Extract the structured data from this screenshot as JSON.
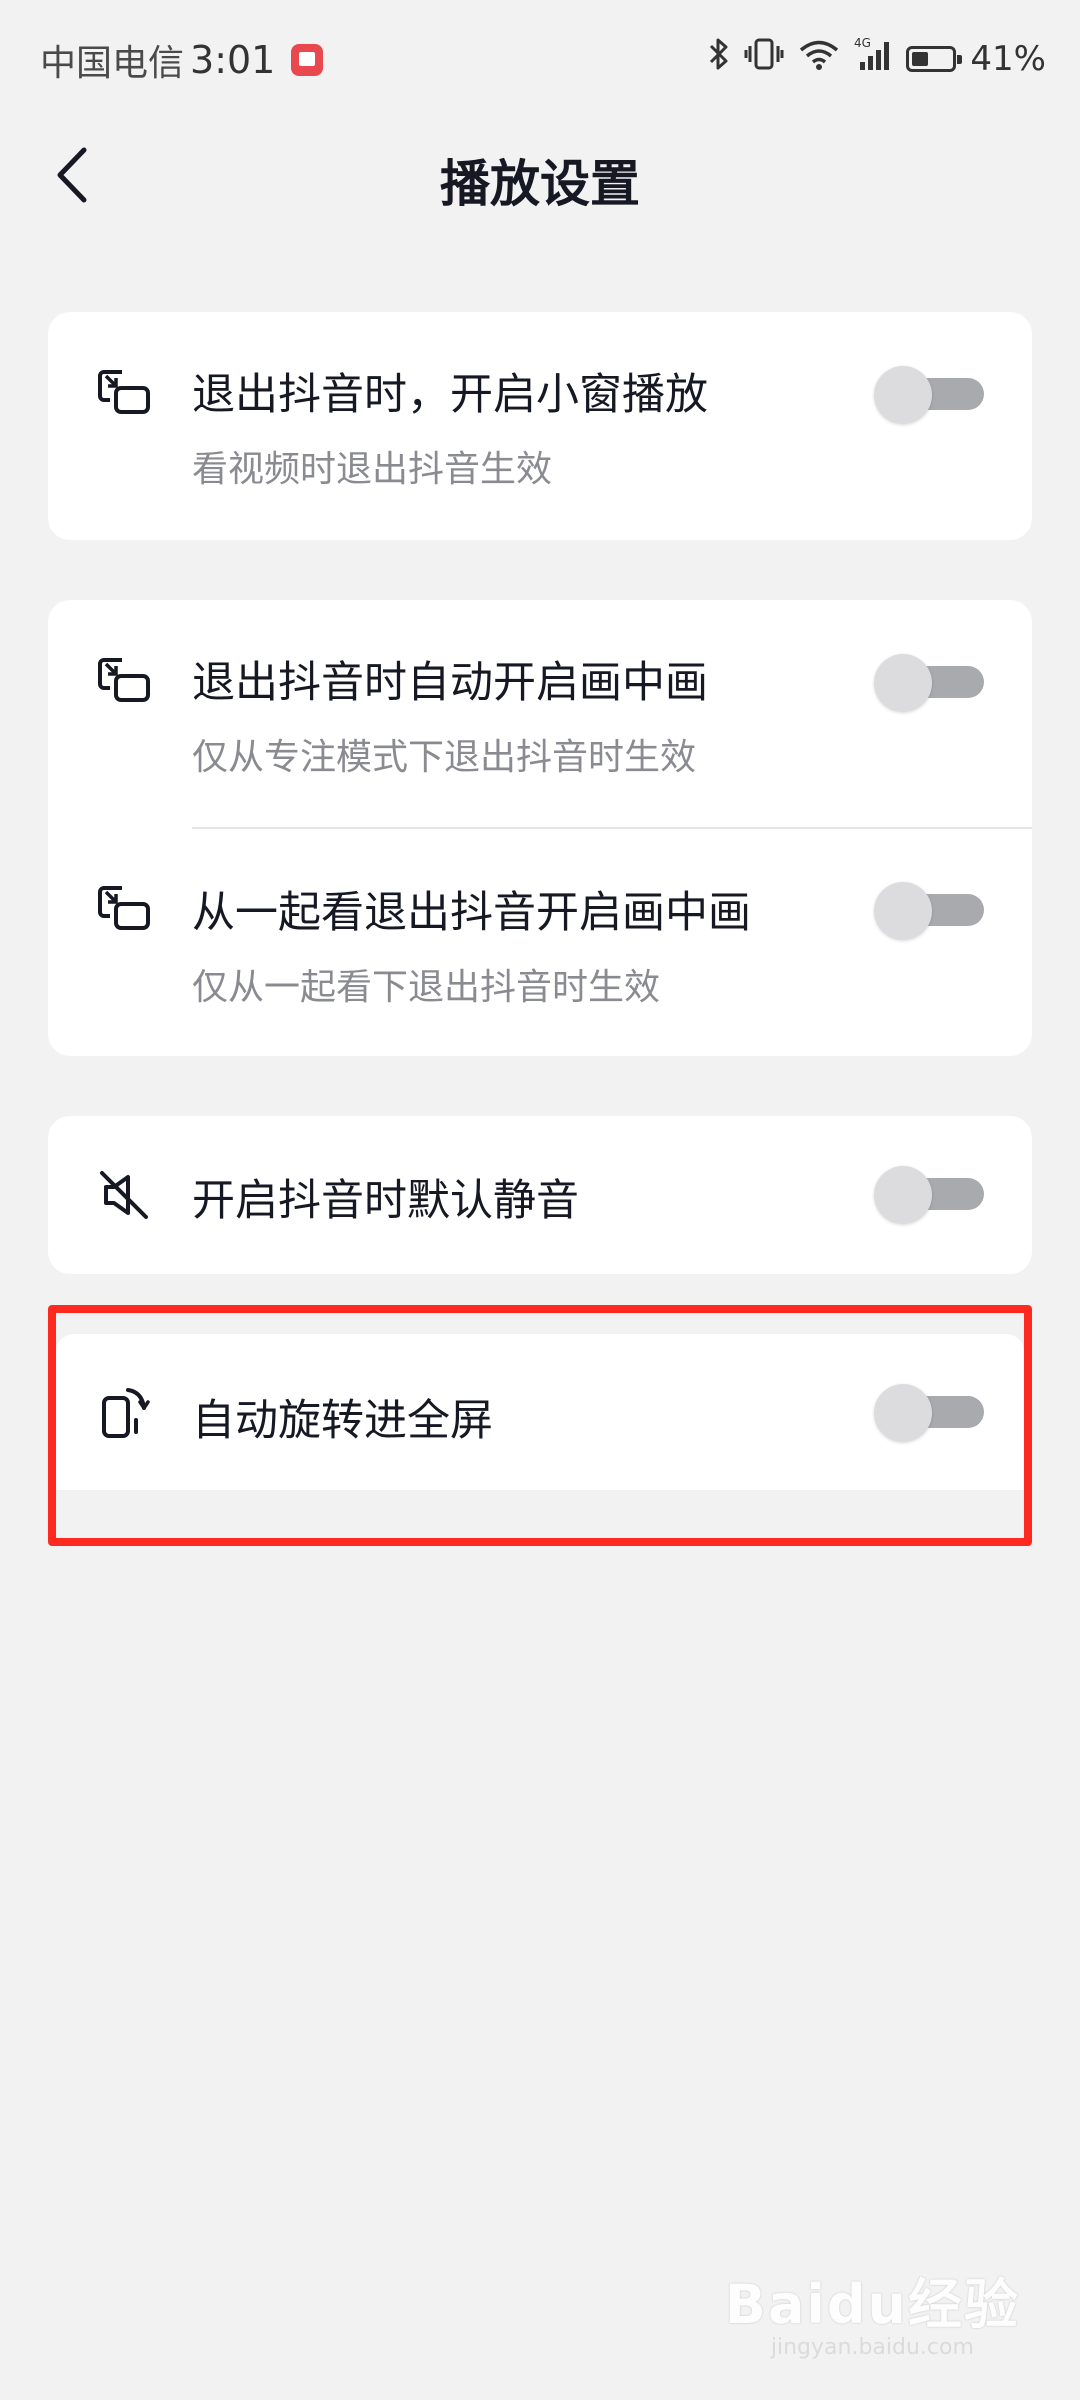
{
  "status_bar": {
    "carrier": "中国电信",
    "time": "3:01",
    "battery": "41%",
    "battery_level": 0.41,
    "network": "4G"
  },
  "header": {
    "title": "播放设置",
    "back_icon": "chevron-left-icon"
  },
  "settings": [
    {
      "title": "退出抖音时，开启小窗播放",
      "subtitle": "看视频时退出抖音生效",
      "icon": "picture-in-picture-icon",
      "enabled": false
    },
    {
      "title": "退出抖音时自动开启画中画",
      "subtitle": "仅从专注模式下退出抖音时生效",
      "icon": "picture-in-picture-icon",
      "enabled": false
    },
    {
      "title": "从一起看退出抖音开启画中画",
      "subtitle": "仅从一起看下退出抖音时生效",
      "icon": "picture-in-picture-icon",
      "enabled": false
    },
    {
      "title": "开启抖音时默认静音",
      "subtitle": "",
      "icon": "mute-icon",
      "enabled": false
    },
    {
      "title": "自动旋转进全屏",
      "subtitle": "",
      "icon": "rotate-screen-icon",
      "enabled": false
    }
  ],
  "colors": {
    "background": "#f2f2f3",
    "card": "#ffffff",
    "highlight_border": "#ff2a1f",
    "toggle_track_off": "#a9aaae",
    "toggle_knob_off": "#dcdcde"
  },
  "watermark": {
    "main": "Baidu经验",
    "sub": "jingyan.baidu.com"
  }
}
